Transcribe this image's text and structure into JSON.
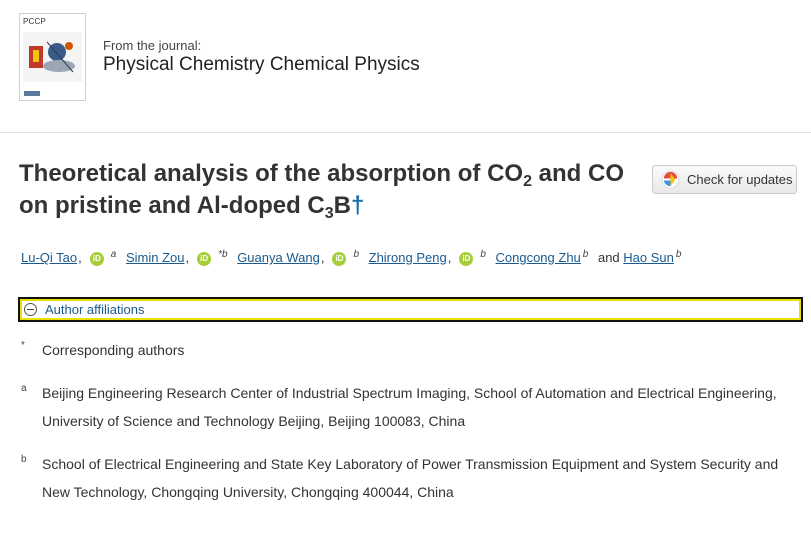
{
  "journal": {
    "cover_label": "PCCP",
    "from_label": "From the journal:",
    "name": "Physical Chemistry Chemical Physics"
  },
  "article": {
    "title_part1": "Theoretical analysis of the absorption of CO",
    "title_sub1": "2",
    "title_part2": " and CO on pristine and Al-doped C",
    "title_sub2": "3",
    "title_part3": "B",
    "title_dagger": "†"
  },
  "updates_button": {
    "label": "Check for updates"
  },
  "authors": [
    {
      "name": "Lu-Qi Tao",
      "orcid": "iD",
      "aff": "a"
    },
    {
      "name": "Simin Zou",
      "orcid": "iD",
      "aff": "*b"
    },
    {
      "name": "Guanya Wang",
      "orcid": "iD",
      "aff": "b"
    },
    {
      "name": "Zhirong Peng",
      "orcid": "iD",
      "aff": "b"
    },
    {
      "name": "Congcong Zhu",
      "aff": "b"
    },
    {
      "name": "Hao Sun",
      "aff": "b"
    }
  ],
  "authors_and": "and",
  "authors_sep": ",",
  "affiliations": {
    "toggle_label": "Author affiliations",
    "items": [
      {
        "marker": "*",
        "text": "Corresponding authors"
      },
      {
        "marker": "a",
        "text": "Beijing Engineering Research Center of Industrial Spectrum Imaging, School of Automation and Electrical Engineering, University of Science and Technology Beijing, Beijing 100083, China"
      },
      {
        "marker": "b",
        "text": "School of Electrical Engineering and State Key Laboratory of Power Transmission Equipment and System Security and New Technology, Chongqing University, Chongqing 400044, China"
      }
    ]
  },
  "colors": {
    "link": "#1a5a8e",
    "orcid": "#a6ce39",
    "focus_outline": "#e8e000"
  }
}
